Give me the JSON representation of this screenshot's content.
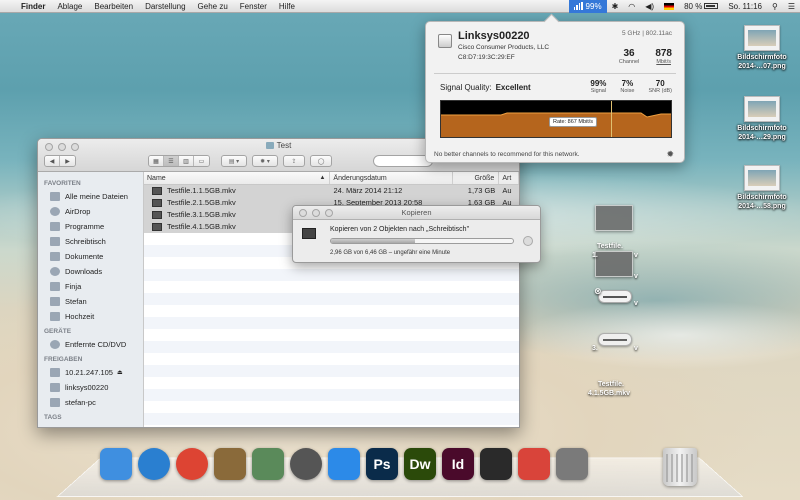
{
  "menubar": {
    "app_name": "Finder",
    "items": [
      "Ablage",
      "Bearbeiten",
      "Darstellung",
      "Gehe zu",
      "Fenster",
      "Hilfe"
    ],
    "wifi_percent": "99%",
    "battery": "80 %",
    "clock": "So. 11:16"
  },
  "desktop_files": [
    {
      "name": "Bildschirmfoto\n2014-…07.png"
    },
    {
      "name": "Bildschirmfoto\n2014-…29.png"
    },
    {
      "name": "Bildschirmfoto\n2014-…58.png"
    }
  ],
  "drag_labels": {
    "l1": "Testfile.",
    "l2": "1.",
    "l3": "v",
    "l4": "v",
    "l5": "v",
    "l6": "3.",
    "l7": "v",
    "l8": "Testfile.",
    "l9": "4.1.5GB.mkv"
  },
  "wifi_popup": {
    "ssid": "Linksys00220",
    "band": "5 GHz | 802.11ac",
    "vendor": "Cisco Consumer Products, LLC",
    "mac": "C8:D7:19:3C:29:EF",
    "channel": "36",
    "channel_label": "Channel",
    "rate": "878",
    "rate_label": "Mbit/s",
    "quality_label": "Signal Quality:",
    "quality_value": "Excellent",
    "signal": "99%",
    "signal_label": "Signal",
    "noise": "7%",
    "noise_label": "Noise",
    "snr": "70",
    "snr_label": "SNR (dB)",
    "rate_tag": "Rate: 867 Mbit/s",
    "footer": "No better channels to recommend for this network."
  },
  "finder": {
    "title": "Test",
    "sidebar": {
      "favorites_header": "FAVORITEN",
      "favorites": [
        "Alle meine Dateien",
        "AirDrop",
        "Programme",
        "Schreibtisch",
        "Dokumente",
        "Downloads",
        "Finja",
        "Stefan",
        "Hochzeit"
      ],
      "devices_header": "GERÄTE",
      "devices": [
        "Entfernte CD/DVD"
      ],
      "shared_header": "FREIGABEN",
      "shared": [
        "10.21.247.105",
        "linksys00220",
        "stefan-pc"
      ],
      "tags_header": "TAGS"
    },
    "columns": {
      "name": "Name",
      "date": "Änderungsdatum",
      "size": "Größe",
      "kind": "Art"
    },
    "files": [
      {
        "name": "Testfile.1.1.5GB.mkv",
        "date": "24. März 2014 21:12",
        "size": "1,73 GB",
        "kind": "Au"
      },
      {
        "name": "Testfile.2.1.5GB.mkv",
        "date": "15. September 2013 20:58",
        "size": "1,63 GB",
        "kind": "Au"
      },
      {
        "name": "Testfile.3.1.5GB.mkv",
        "date": "",
        "size": "",
        "kind": ""
      },
      {
        "name": "Testfile.4.1.5GB.mkv",
        "date": "",
        "size": "",
        "kind": ""
      }
    ]
  },
  "copy_dialog": {
    "title": "Kopieren",
    "label": "Kopieren von 2 Objekten nach „Schreibtisch\"",
    "progress": 0.46,
    "status": "2,96 GB von 6,46 GB – ungefähr eine Minute"
  },
  "dock": {
    "apps": [
      {
        "name": "finder-app",
        "label": "",
        "color": "#3f8fe0"
      },
      {
        "name": "safari-app",
        "label": "",
        "color": "#2a7fd0"
      },
      {
        "name": "chrome-app",
        "label": "",
        "color": "#dd4433"
      },
      {
        "name": "mail-app",
        "label": "",
        "color": "#8a6a3a"
      },
      {
        "name": "iphoto-app",
        "label": "",
        "color": "#5a8a5a"
      },
      {
        "name": "facetime-app",
        "label": "",
        "color": "#555555"
      },
      {
        "name": "appstore-app",
        "label": "",
        "color": "#2c8ae8"
      },
      {
        "name": "photoshop-app",
        "label": "Ps",
        "color": "#0a2b4a"
      },
      {
        "name": "dreamweaver-app",
        "label": "Dw",
        "color": "#2b4a0a"
      },
      {
        "name": "indesign-app",
        "label": "Id",
        "color": "#4a0a2b"
      },
      {
        "name": "activity-monitor-app",
        "label": "",
        "color": "#2a2a2a"
      },
      {
        "name": "remote-desktop-app",
        "label": "",
        "color": "#d9443a"
      },
      {
        "name": "system-prefs-app",
        "label": "",
        "color": "#7a7a7a"
      }
    ]
  }
}
